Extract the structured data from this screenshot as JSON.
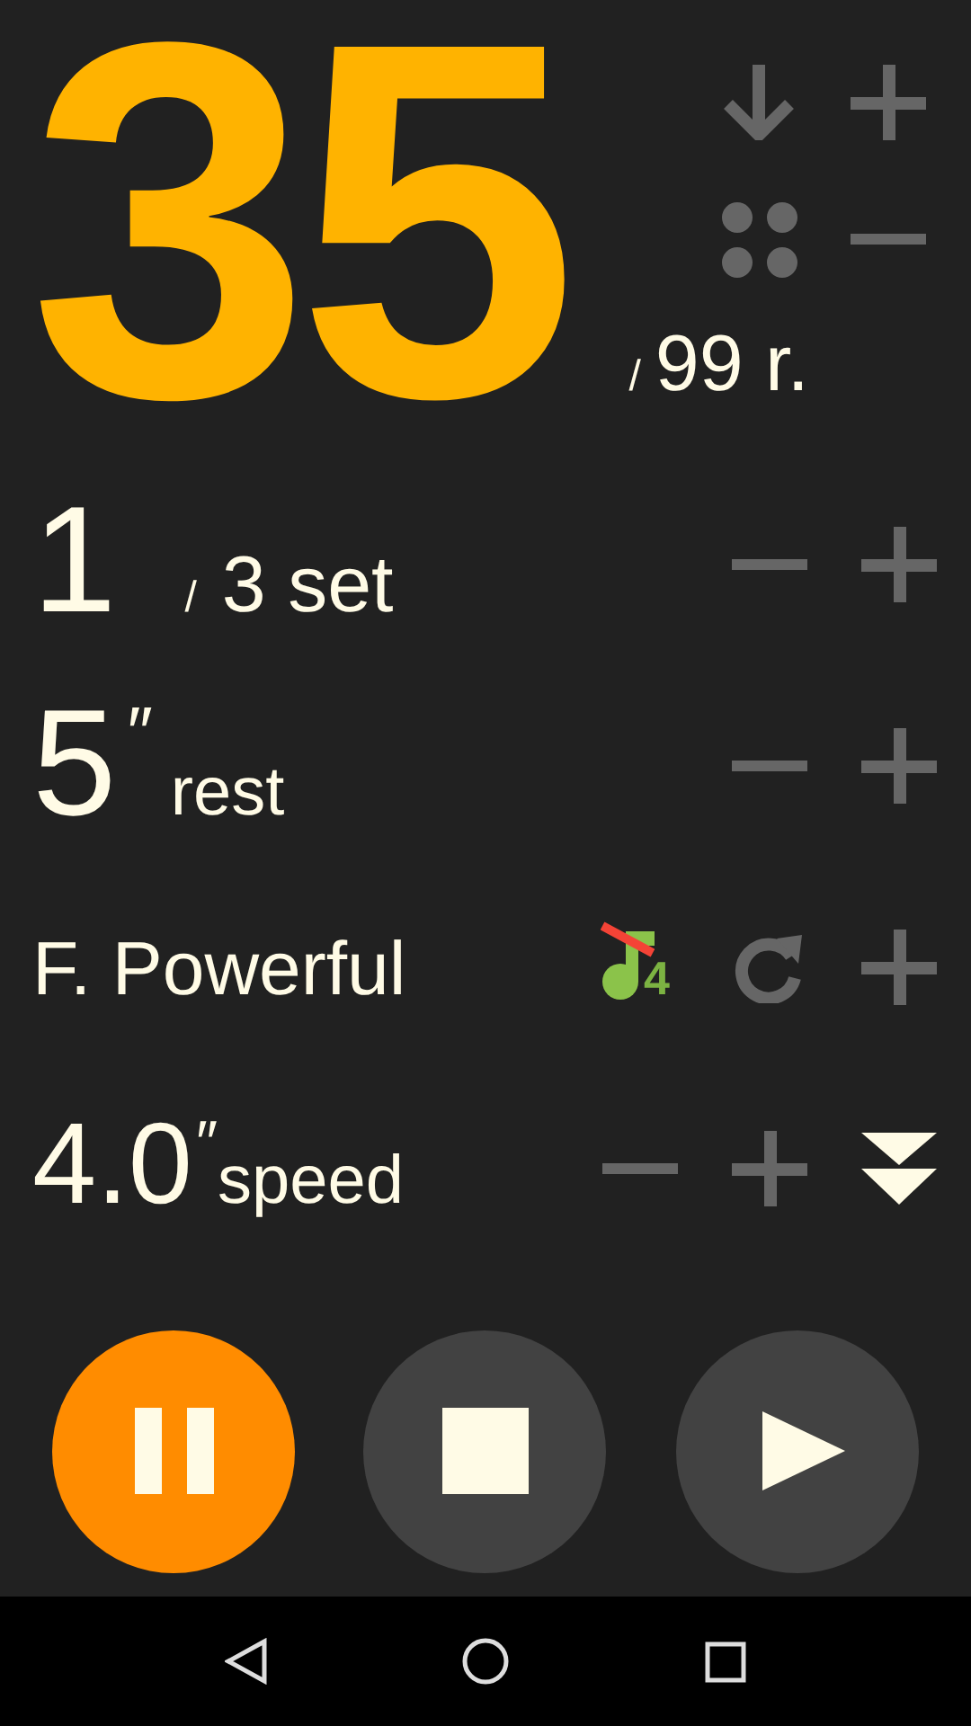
{
  "counter": {
    "value": "35",
    "slash": "/",
    "total": "99",
    "unit": "r.",
    "buttons": [
      {
        "kind": "arrow-down"
      },
      {
        "kind": "plus"
      },
      {
        "kind": "dots"
      },
      {
        "kind": "minus"
      }
    ]
  },
  "rows": [
    {
      "kind": "sets",
      "value": "1",
      "slash": "/",
      "total": "3",
      "unit": "set",
      "buttons": [
        {
          "kind": "minus"
        },
        {
          "kind": "plus"
        }
      ]
    },
    {
      "kind": "rest",
      "value": "5",
      "mark": "″",
      "unit": "rest",
      "buttons": [
        {
          "kind": "minus"
        },
        {
          "kind": "plus"
        }
      ]
    },
    {
      "kind": "voice",
      "label": "F. Powerful",
      "buttons": [
        {
          "kind": "tempo",
          "badge": "4"
        },
        {
          "kind": "refresh"
        },
        {
          "kind": "plus"
        }
      ]
    },
    {
      "kind": "speed",
      "value": "4.0",
      "mark": "″",
      "unit": "speed",
      "buttons": [
        {
          "kind": "minus"
        },
        {
          "kind": "plus"
        },
        {
          "kind": "chevrons"
        }
      ]
    }
  ],
  "controls": [
    {
      "kind": "pause",
      "active": true
    },
    {
      "kind": "stop",
      "active": false
    },
    {
      "kind": "play",
      "active": false
    }
  ],
  "nav": [
    {
      "kind": "back"
    },
    {
      "kind": "home"
    },
    {
      "kind": "recents"
    }
  ]
}
